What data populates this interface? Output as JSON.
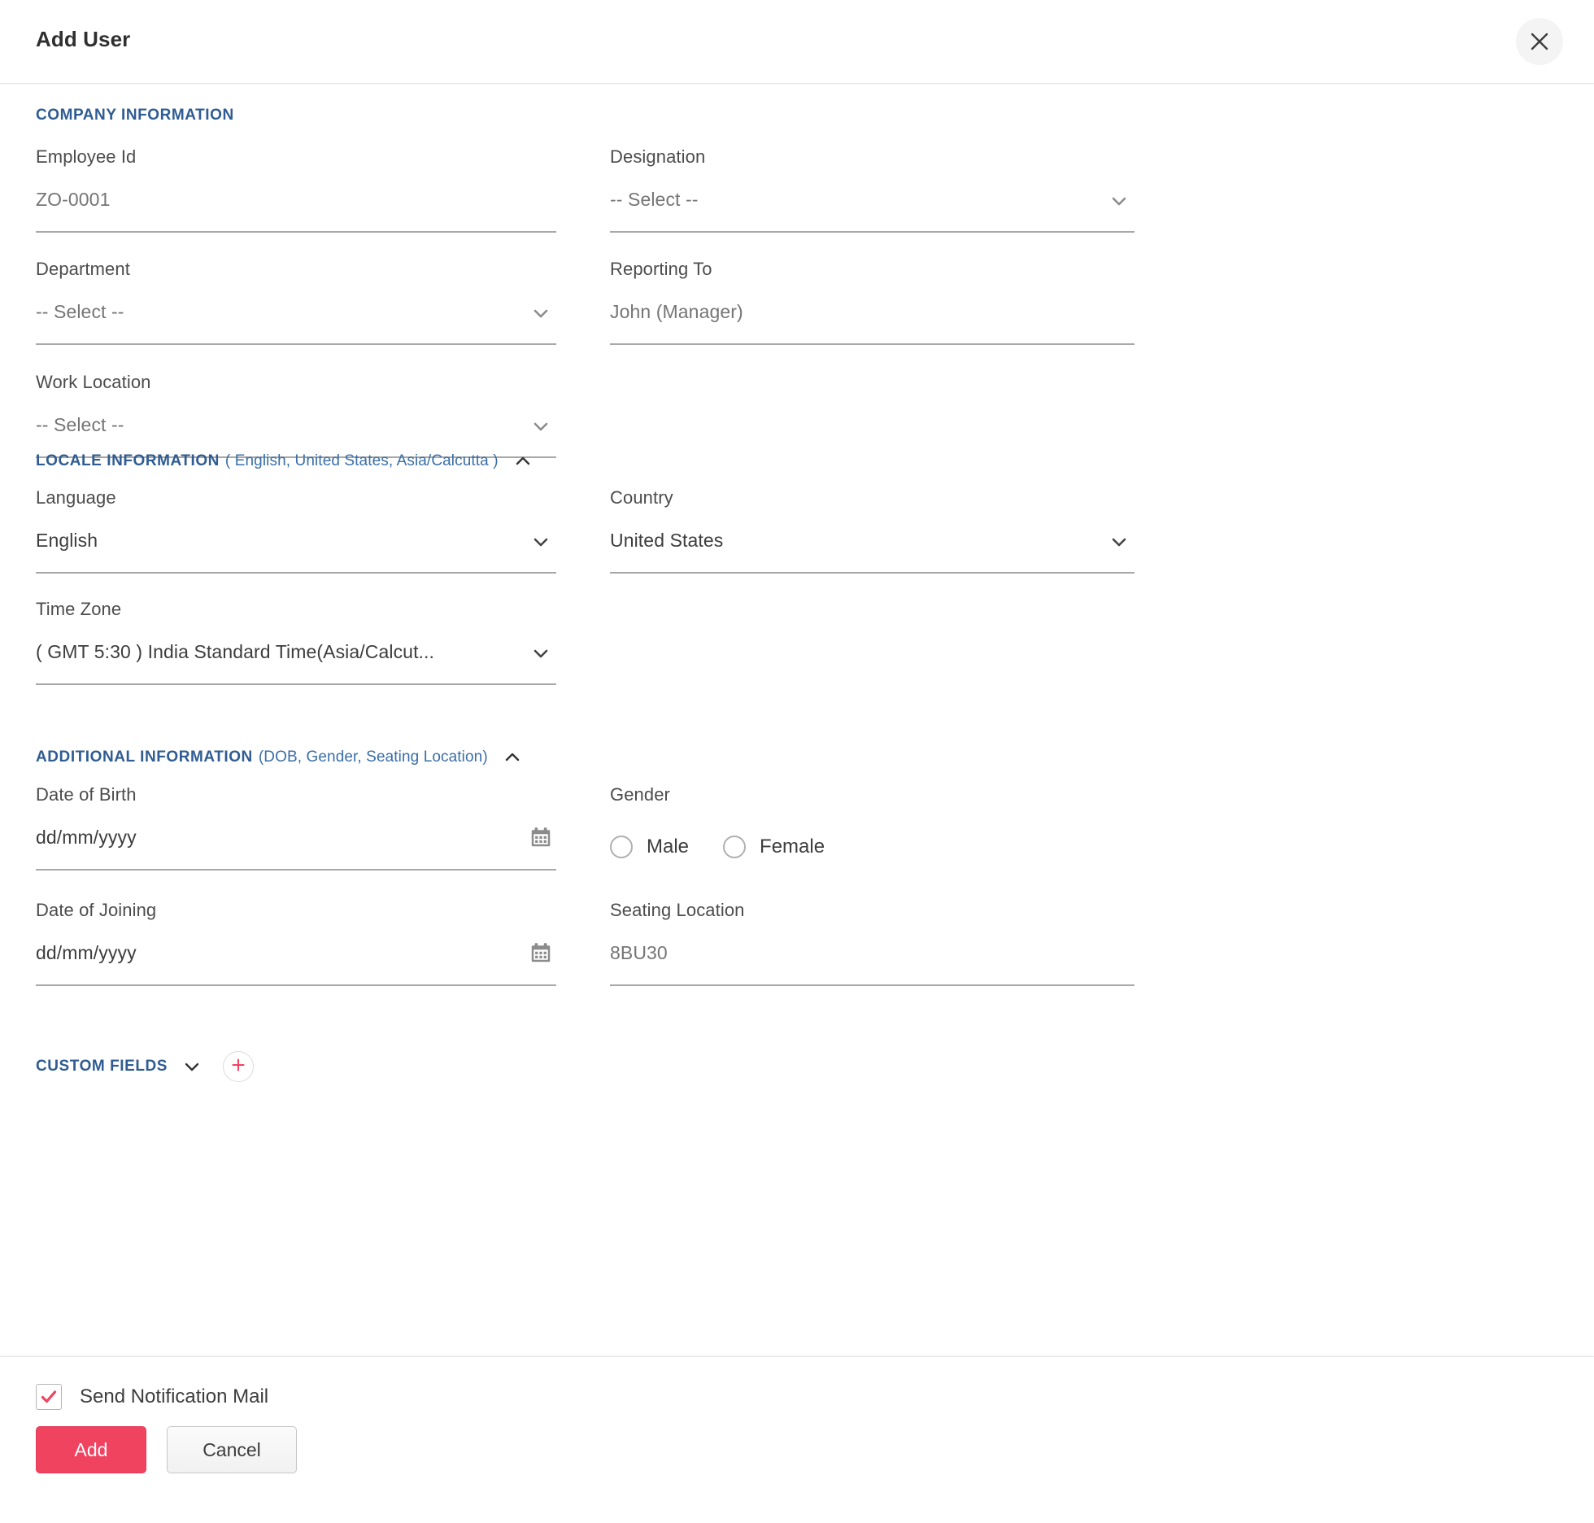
{
  "header": {
    "title": "Add User",
    "close_icon": "close-icon"
  },
  "sections": {
    "company": {
      "title": "COMPANY INFORMATION",
      "fields": {
        "employee_id": {
          "label": "Employee Id",
          "value": "",
          "placeholder": "ZO-0001"
        },
        "designation": {
          "label": "Designation",
          "value": "",
          "placeholder": "-- Select --"
        },
        "department": {
          "label": "Department",
          "value": "",
          "placeholder": "-- Select --"
        },
        "reporting_to": {
          "label": "Reporting To",
          "value": "",
          "placeholder": "John (Manager)"
        },
        "work_location": {
          "label": "Work Location",
          "value": "",
          "placeholder": "-- Select --"
        }
      }
    },
    "locale": {
      "title": "LOCALE INFORMATION",
      "summary": "( English, United States, Asia/Calcutta )",
      "collapse_icon": "chevron-up-icon",
      "fields": {
        "language": {
          "label": "Language",
          "value": "English"
        },
        "country": {
          "label": "Country",
          "value": "United States"
        },
        "time_zone": {
          "label": "Time Zone",
          "value": "( GMT 5:30 ) India Standard Time(Asia/Calcut..."
        }
      }
    },
    "additional": {
      "title": "ADDITIONAL INFORMATION",
      "summary": "(DOB, Gender, Seating Location)",
      "collapse_icon": "chevron-up-icon",
      "fields": {
        "date_of_birth": {
          "label": "Date of Birth",
          "value": "dd/mm/yyyy",
          "icon": "calendar-icon"
        },
        "gender": {
          "label": "Gender",
          "options": [
            {
              "label": "Male",
              "selected": false
            },
            {
              "label": "Female",
              "selected": false
            }
          ]
        },
        "date_of_joining": {
          "label": "Date of Joining",
          "value": "dd/mm/yyyy",
          "icon": "calendar-icon"
        },
        "seating_location": {
          "label": "Seating Location",
          "value": "",
          "placeholder": "8BU30"
        }
      }
    },
    "custom": {
      "title": "CUSTOM FIELDS",
      "expand_icon": "chevron-down-icon",
      "add_icon": "plus-icon"
    }
  },
  "footer": {
    "notification": {
      "label": "Send Notification Mail",
      "checked": true
    },
    "add_label": "Add",
    "cancel_label": "Cancel"
  },
  "colors": {
    "section_title": "#2f5c92",
    "accent_pink": "#ef4360",
    "underline": "#a8a8a8",
    "placeholder": "#a6a6a6"
  }
}
